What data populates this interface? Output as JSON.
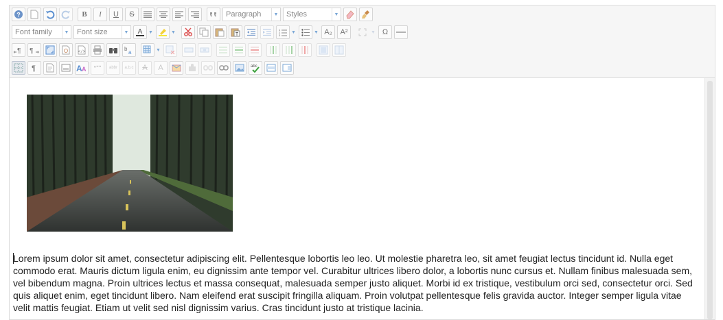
{
  "toolbar": {
    "row1": {
      "format_select": "Paragraph",
      "styles_select": "Styles"
    },
    "row2": {
      "font_family_select": "Font family",
      "font_size_select": "Font size",
      "buttons": {
        "bold": "B",
        "italic": "I",
        "underline": "U",
        "strikethrough": "S",
        "subscript": "A₂",
        "superscript": "A²",
        "omega": "Ω"
      }
    }
  },
  "content": {
    "paragraph": "Lorem ipsum dolor sit amet, consectetur adipiscing elit. Pellentesque lobortis leo leo. Ut molestie pharetra leo, sit amet feugiat lectus tincidunt id. Nulla eget commodo erat. Mauris dictum ligula enim, eu dignissim ante tempor vel. Curabitur ultrices libero dolor, a lobortis nunc cursus et. Nullam finibus malesuada sem, vel bibendum magna. Proin ultrices lectus et massa consequat, malesuada semper justo aliquet. Morbi id ex tristique, vestibulum orci sed, consectetur orci. Sed quis aliquet enim, eget tincidunt libero. Nam eleifend erat suscipit fringilla aliquam. Proin volutpat pellentesque felis gravida auctor. Integer semper ligula vitae velit mattis feugiat. Etiam ut velit sed nisl dignissim varius. Cras tincidunt justo at tristique lacinia."
  },
  "colors": {
    "accent": "#7aa7d6",
    "toolbar_bg": "#f6f6f6",
    "border": "#dcdcdc"
  }
}
